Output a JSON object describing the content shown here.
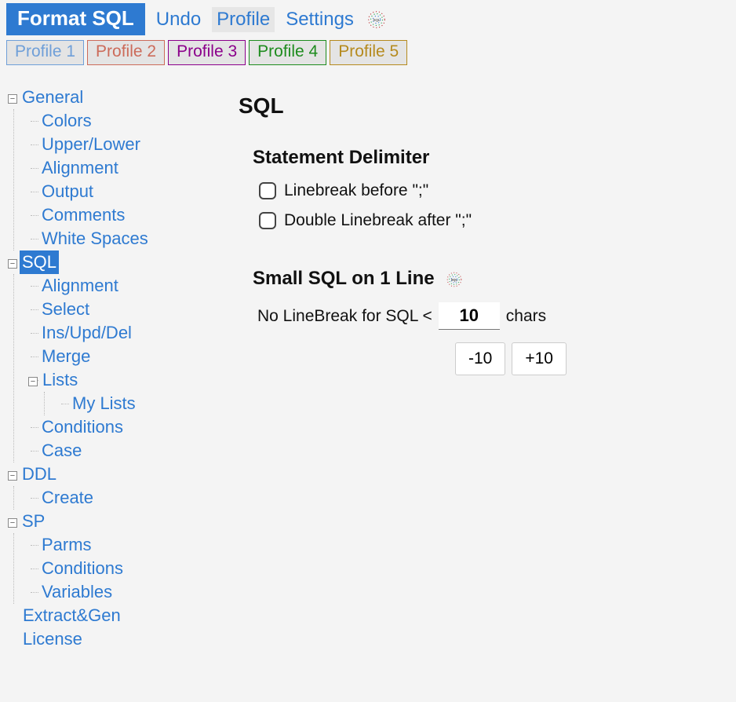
{
  "toolbar": {
    "format_label": "Format SQL",
    "undo_label": "Undo",
    "profile_label": "Profile",
    "settings_label": "Settings"
  },
  "profiles": [
    {
      "label": "Profile 1",
      "color": "#6f9fd8",
      "border": "#6f9fd8"
    },
    {
      "label": "Profile 2",
      "color": "#cc6b5a",
      "border": "#cc6b5a"
    },
    {
      "label": "Profile 3",
      "color": "#8b008b",
      "border": "#8b008b"
    },
    {
      "label": "Profile 4",
      "color": "#1e8c1e",
      "border": "#1e8c1e"
    },
    {
      "label": "Profile 5",
      "color": "#b58a1e",
      "border": "#b58a1e"
    }
  ],
  "tree": {
    "general": {
      "label": "General",
      "children": {
        "colors": "Colors",
        "upper_lower": "Upper/Lower",
        "alignment": "Alignment",
        "output": "Output",
        "comments": "Comments",
        "white_spaces": "White Spaces"
      }
    },
    "sql": {
      "label": "SQL",
      "selected": true,
      "children": {
        "alignment": "Alignment",
        "select": "Select",
        "ins_upd_del": "Ins/Upd/Del",
        "merge": "Merge",
        "lists": {
          "label": "Lists",
          "children": {
            "my_lists": "My Lists"
          }
        },
        "conditions": "Conditions",
        "case": "Case"
      }
    },
    "ddl": {
      "label": "DDL",
      "children": {
        "create": "Create"
      }
    },
    "sp": {
      "label": "SP",
      "children": {
        "parms": "Parms",
        "conditions": "Conditions",
        "variables": "Variables"
      }
    },
    "extract_gen": "Extract&Gen",
    "license": "License"
  },
  "panel": {
    "title": "SQL",
    "section1": {
      "heading": "Statement Delimiter",
      "cb1_label": "Linebreak before \";\"",
      "cb2_label": "Double Linebreak after \";\"",
      "cb1_checked": false,
      "cb2_checked": false
    },
    "section2": {
      "heading": "Small SQL on 1 Line",
      "prefix": "No LineBreak for  SQL <",
      "value": "10",
      "suffix": "chars",
      "dec_label": "-10",
      "inc_label": "+10"
    }
  }
}
